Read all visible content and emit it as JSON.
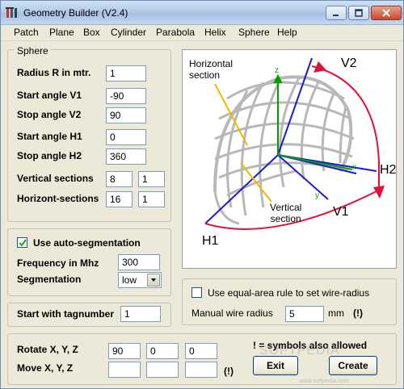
{
  "window": {
    "title": "Geometry Builder (V2.4)",
    "controls": {
      "minimize_icon": "minimize-icon",
      "maximize_icon": "maximize-icon",
      "close_icon": "close-icon"
    }
  },
  "menu": [
    "Patch",
    "Plane",
    "Box",
    "Cylinder",
    "Parabola",
    "Helix",
    "Sphere",
    "Help"
  ],
  "sphere_group": {
    "title": "Sphere",
    "radius_label": "Radius R in mtr.",
    "radius_value": "1",
    "start_v1_label": "Start angle V1",
    "start_v1_value": "-90",
    "stop_v2_label": "Stop angle V2",
    "stop_v2_value": "90",
    "start_h1_label": "Start angle H1",
    "start_h1_value": "0",
    "stop_h2_label": "Stop angle H2",
    "stop_h2_value": "360",
    "vertical_label": "Vertical sections",
    "vertical_value": "8",
    "vertical_value2": "1",
    "horizontal_label": "Horizont-sections",
    "horizontal_value": "16",
    "horizontal_value2": "1"
  },
  "segmentation_group": {
    "auto_label": "Use auto-segmentation",
    "auto_checked": true,
    "frequency_label": "Frequency in Mhz",
    "frequency_value": "300",
    "segmentation_label": "Segmentation",
    "segmentation_value": "low"
  },
  "tag_group": {
    "label": "Start with tagnumber",
    "value": "1"
  },
  "wire_group": {
    "equal_area_label": "Use equal-area rule to set wire-radius",
    "equal_area_checked": false,
    "manual_label": "Manual wire radius",
    "manual_value": "5",
    "unit": "mm",
    "hint": "(!)"
  },
  "transform_group": {
    "rotate_label": "Rotate X, Y, Z",
    "rotate_x": "90",
    "rotate_y": "0",
    "rotate_z": "0",
    "move_label": "Move X, Y, Z",
    "move_x": "",
    "move_y": "",
    "move_z": "",
    "hint": "(!)"
  },
  "symbols_note": "! = symbols also allowed",
  "buttons": {
    "exit": "Exit",
    "create": "Create"
  },
  "diagram": {
    "horizontal_section": "Horizontal\nsection",
    "vertical_section": "Vertical\nsection",
    "v1": "V1",
    "v2": "V2",
    "h1": "H1",
    "h2": "H2",
    "z": "z",
    "x": "x",
    "y": "y",
    "colors": {
      "axis": "#1a1ad0",
      "arc": "#e0103a",
      "pointer": "#f0b800",
      "z_axis": "#00a000",
      "mesh": "#bdbdbd"
    }
  },
  "watermark": "SOFTPEDIA",
  "watermark_sub": "www.softpedia.com"
}
